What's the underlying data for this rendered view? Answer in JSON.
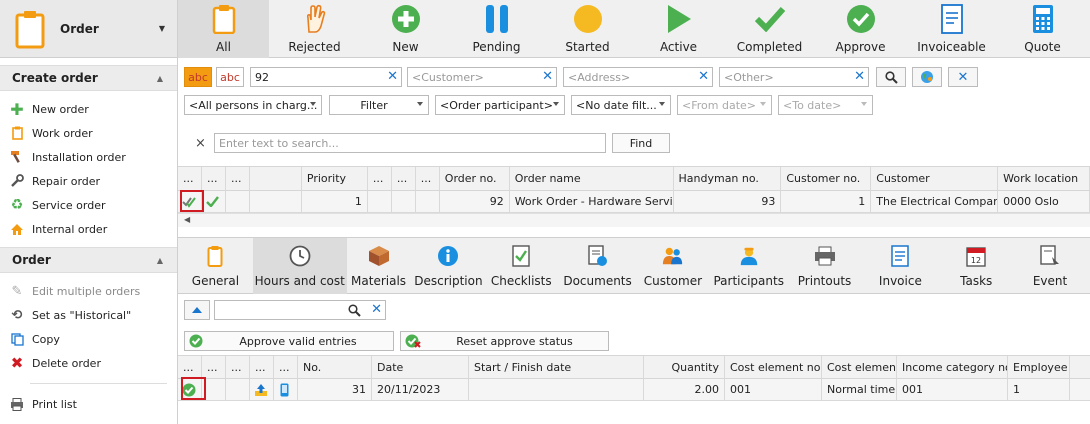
{
  "sidebar": {
    "title": "Order",
    "sections": [
      {
        "label": "Create order",
        "items": [
          "New order",
          "Work order",
          "Installation order",
          "Repair order",
          "Service order",
          "Internal order"
        ]
      },
      {
        "label": "Order",
        "items": [
          "Edit multiple orders",
          "Set as \"Historical\"",
          "Copy",
          "Delete order"
        ]
      }
    ],
    "print": "Print list"
  },
  "toolbar": {
    "items": [
      "All",
      "Rejected",
      "New",
      "Pending",
      "Started",
      "Active",
      "Completed",
      "Approve",
      "Invoiceable",
      "Quote"
    ]
  },
  "filters": {
    "abc1": "abc",
    "abc2": "abc",
    "search_value": "92",
    "customer_ph": "<Customer>",
    "address_ph": "<Address>",
    "other_ph": "<Other>",
    "persons": "<All persons in charg...",
    "filter": "Filter",
    "participant": "<Order participant>",
    "date_filter": "<No date filt...",
    "from_date": "<From date>",
    "to_date": "<To date>",
    "text_search_ph": "Enter text to search...",
    "find": "Find",
    "clear": "×"
  },
  "orders": {
    "headers": [
      "...",
      "...",
      "...",
      "Priority",
      "...",
      "...",
      "...",
      "Order no.",
      "Order name",
      "Handyman no.",
      "Customer no.",
      "Customer",
      "Work location"
    ],
    "row": {
      "priority": "1",
      "order_no": "92",
      "order_name": "Work Order - Hardware Service",
      "handyman_no": "93",
      "customer_no": "1",
      "customer": "The Electrical Company",
      "work_location": "0000 Oslo"
    }
  },
  "tabs": [
    "General",
    "Hours and cost",
    "Materials",
    "Description",
    "Checklists",
    "Documents",
    "Customer",
    "Participants",
    "Printouts",
    "Invoice",
    "Tasks",
    "Event"
  ],
  "hours": {
    "approve_valid": "Approve valid entries",
    "reset_approve": "Reset approve status",
    "headers": [
      "...",
      "...",
      "...",
      "...",
      "No.",
      "Date",
      "Start / Finish date",
      "Quantity",
      "Cost element no.",
      "Cost element",
      "Income category no.",
      "Employee"
    ],
    "row": {
      "no": "31",
      "date": "20/11/2023",
      "start_finish": "",
      "quantity": "2.00",
      "cost_element_no": "001",
      "cost_element": "Normal time",
      "income_category_no": "001",
      "employee": "1"
    }
  },
  "colors": {
    "accent": "#f39c12",
    "green": "#4caf50",
    "blue": "#1a75cf",
    "red": "#d11b22"
  }
}
